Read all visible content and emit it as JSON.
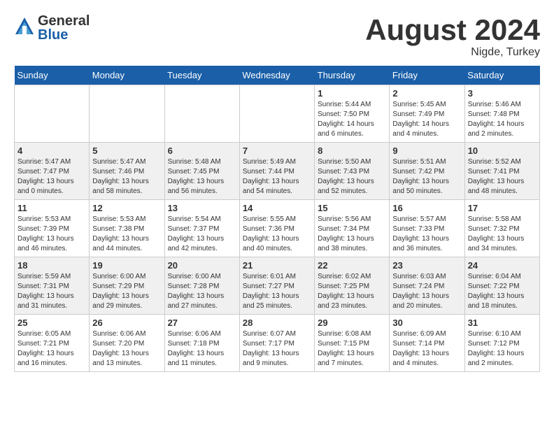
{
  "logo": {
    "general": "General",
    "blue": "Blue"
  },
  "title": {
    "month": "August 2024",
    "location": "Nigde, Turkey"
  },
  "days_of_week": [
    "Sunday",
    "Monday",
    "Tuesday",
    "Wednesday",
    "Thursday",
    "Friday",
    "Saturday"
  ],
  "weeks": [
    [
      {
        "day": "",
        "info": ""
      },
      {
        "day": "",
        "info": ""
      },
      {
        "day": "",
        "info": ""
      },
      {
        "day": "",
        "info": ""
      },
      {
        "day": "1",
        "info": "Sunrise: 5:44 AM\nSunset: 7:50 PM\nDaylight: 14 hours and 6 minutes."
      },
      {
        "day": "2",
        "info": "Sunrise: 5:45 AM\nSunset: 7:49 PM\nDaylight: 14 hours and 4 minutes."
      },
      {
        "day": "3",
        "info": "Sunrise: 5:46 AM\nSunset: 7:48 PM\nDaylight: 14 hours and 2 minutes."
      }
    ],
    [
      {
        "day": "4",
        "info": "Sunrise: 5:47 AM\nSunset: 7:47 PM\nDaylight: 13 hours and 0 minutes."
      },
      {
        "day": "5",
        "info": "Sunrise: 5:47 AM\nSunset: 7:46 PM\nDaylight: 13 hours and 58 minutes."
      },
      {
        "day": "6",
        "info": "Sunrise: 5:48 AM\nSunset: 7:45 PM\nDaylight: 13 hours and 56 minutes."
      },
      {
        "day": "7",
        "info": "Sunrise: 5:49 AM\nSunset: 7:44 PM\nDaylight: 13 hours and 54 minutes."
      },
      {
        "day": "8",
        "info": "Sunrise: 5:50 AM\nSunset: 7:43 PM\nDaylight: 13 hours and 52 minutes."
      },
      {
        "day": "9",
        "info": "Sunrise: 5:51 AM\nSunset: 7:42 PM\nDaylight: 13 hours and 50 minutes."
      },
      {
        "day": "10",
        "info": "Sunrise: 5:52 AM\nSunset: 7:41 PM\nDaylight: 13 hours and 48 minutes."
      }
    ],
    [
      {
        "day": "11",
        "info": "Sunrise: 5:53 AM\nSunset: 7:39 PM\nDaylight: 13 hours and 46 minutes."
      },
      {
        "day": "12",
        "info": "Sunrise: 5:53 AM\nSunset: 7:38 PM\nDaylight: 13 hours and 44 minutes."
      },
      {
        "day": "13",
        "info": "Sunrise: 5:54 AM\nSunset: 7:37 PM\nDaylight: 13 hours and 42 minutes."
      },
      {
        "day": "14",
        "info": "Sunrise: 5:55 AM\nSunset: 7:36 PM\nDaylight: 13 hours and 40 minutes."
      },
      {
        "day": "15",
        "info": "Sunrise: 5:56 AM\nSunset: 7:34 PM\nDaylight: 13 hours and 38 minutes."
      },
      {
        "day": "16",
        "info": "Sunrise: 5:57 AM\nSunset: 7:33 PM\nDaylight: 13 hours and 36 minutes."
      },
      {
        "day": "17",
        "info": "Sunrise: 5:58 AM\nSunset: 7:32 PM\nDaylight: 13 hours and 34 minutes."
      }
    ],
    [
      {
        "day": "18",
        "info": "Sunrise: 5:59 AM\nSunset: 7:31 PM\nDaylight: 13 hours and 31 minutes."
      },
      {
        "day": "19",
        "info": "Sunrise: 6:00 AM\nSunset: 7:29 PM\nDaylight: 13 hours and 29 minutes."
      },
      {
        "day": "20",
        "info": "Sunrise: 6:00 AM\nSunset: 7:28 PM\nDaylight: 13 hours and 27 minutes."
      },
      {
        "day": "21",
        "info": "Sunrise: 6:01 AM\nSunset: 7:27 PM\nDaylight: 13 hours and 25 minutes."
      },
      {
        "day": "22",
        "info": "Sunrise: 6:02 AM\nSunset: 7:25 PM\nDaylight: 13 hours and 23 minutes."
      },
      {
        "day": "23",
        "info": "Sunrise: 6:03 AM\nSunset: 7:24 PM\nDaylight: 13 hours and 20 minutes."
      },
      {
        "day": "24",
        "info": "Sunrise: 6:04 AM\nSunset: 7:22 PM\nDaylight: 13 hours and 18 minutes."
      }
    ],
    [
      {
        "day": "25",
        "info": "Sunrise: 6:05 AM\nSunset: 7:21 PM\nDaylight: 13 hours and 16 minutes."
      },
      {
        "day": "26",
        "info": "Sunrise: 6:06 AM\nSunset: 7:20 PM\nDaylight: 13 hours and 13 minutes."
      },
      {
        "day": "27",
        "info": "Sunrise: 6:06 AM\nSunset: 7:18 PM\nDaylight: 13 hours and 11 minutes."
      },
      {
        "day": "28",
        "info": "Sunrise: 6:07 AM\nSunset: 7:17 PM\nDaylight: 13 hours and 9 minutes."
      },
      {
        "day": "29",
        "info": "Sunrise: 6:08 AM\nSunset: 7:15 PM\nDaylight: 13 hours and 7 minutes."
      },
      {
        "day": "30",
        "info": "Sunrise: 6:09 AM\nSunset: 7:14 PM\nDaylight: 13 hours and 4 minutes."
      },
      {
        "day": "31",
        "info": "Sunrise: 6:10 AM\nSunset: 7:12 PM\nDaylight: 13 hours and 2 minutes."
      }
    ]
  ]
}
